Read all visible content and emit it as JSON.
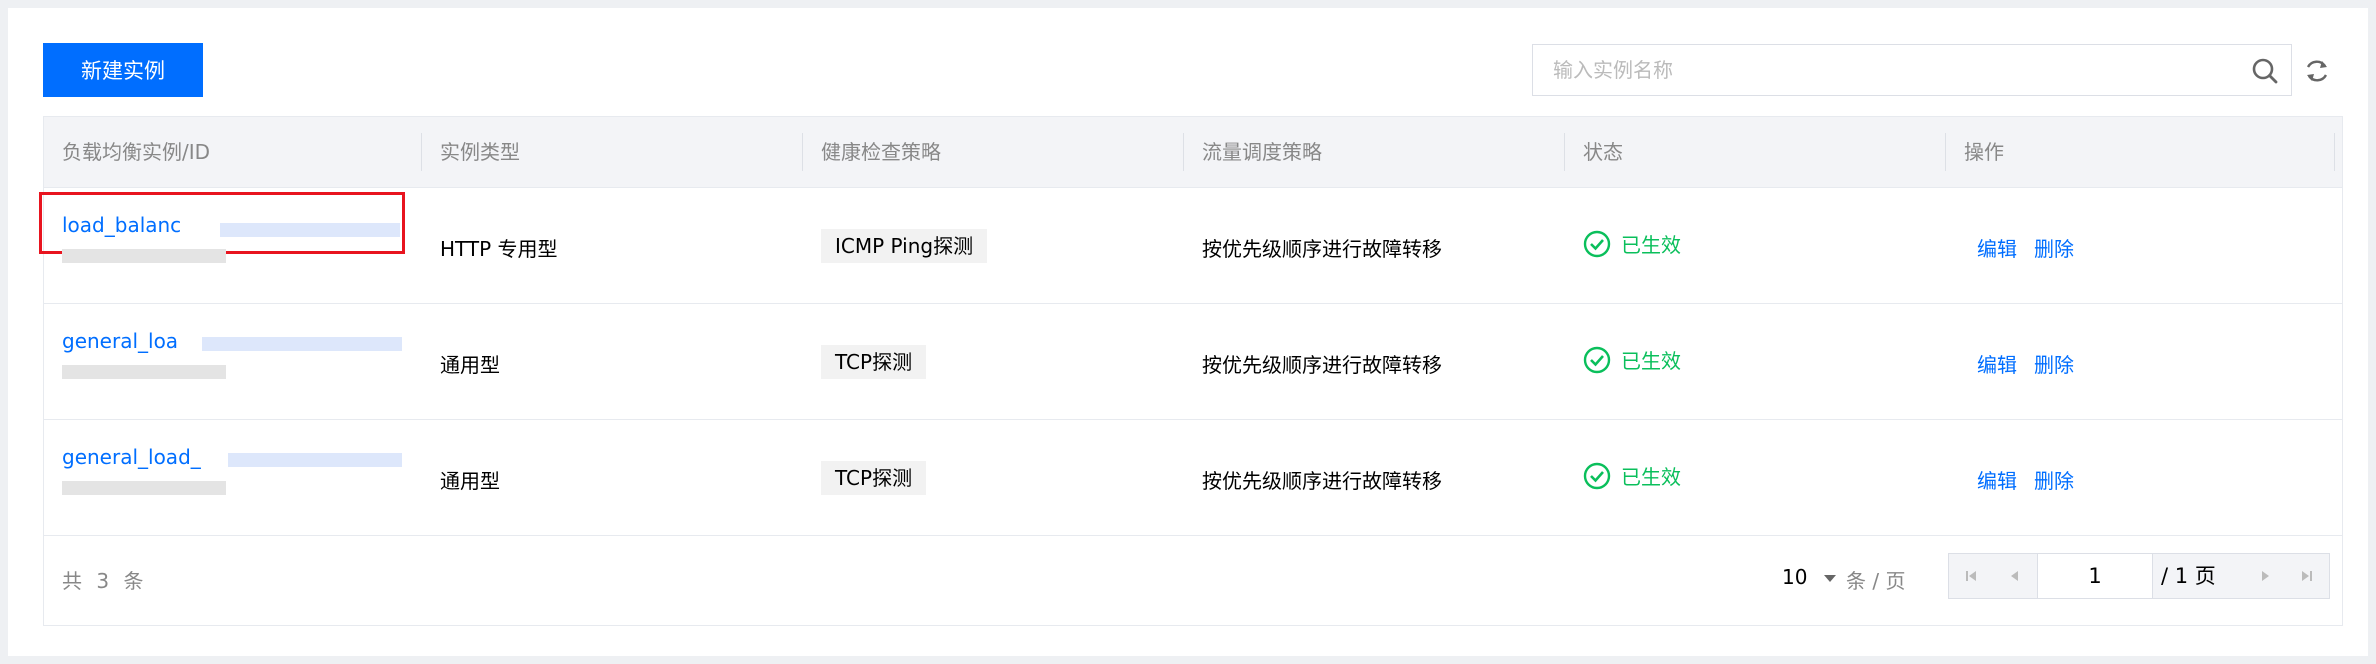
{
  "toolbar": {
    "new_label": "新建实例",
    "search_placeholder": "输入实例名称"
  },
  "table": {
    "columns": [
      "负载均衡实例/ID",
      "实例类型",
      "健康检查策略",
      "流量调度策略",
      "状态",
      "操作"
    ],
    "rows": [
      {
        "name": "load_balanc",
        "type": "HTTP 专用型",
        "health": "ICMP Ping探测",
        "policy": "按优先级顺序进行故障转移",
        "status": "已生效",
        "edit": "编辑",
        "delete": "删除"
      },
      {
        "name": "general_loa",
        "type": "通用型",
        "health": "TCP探测",
        "policy": "按优先级顺序进行故障转移",
        "status": "已生效",
        "edit": "编辑",
        "delete": "删除"
      },
      {
        "name": "general_load_",
        "type": "通用型",
        "health": "TCP探测",
        "policy": "按优先级顺序进行故障转移",
        "status": "已生效",
        "edit": "编辑",
        "delete": "删除"
      }
    ]
  },
  "footer": {
    "total": "共 3 条",
    "page_size": "10",
    "page_size_unit": "条 / 页",
    "current_page": "1",
    "total_pages": "/ 1 页"
  },
  "colors": {
    "primary": "#006eff",
    "success": "#0abf5b",
    "highlight": "#e8141f"
  },
  "icons": [
    "search-icon",
    "refresh-icon",
    "check-circle-icon",
    "caret-down-icon",
    "first-page-icon",
    "prev-page-icon",
    "next-page-icon",
    "last-page-icon"
  ]
}
